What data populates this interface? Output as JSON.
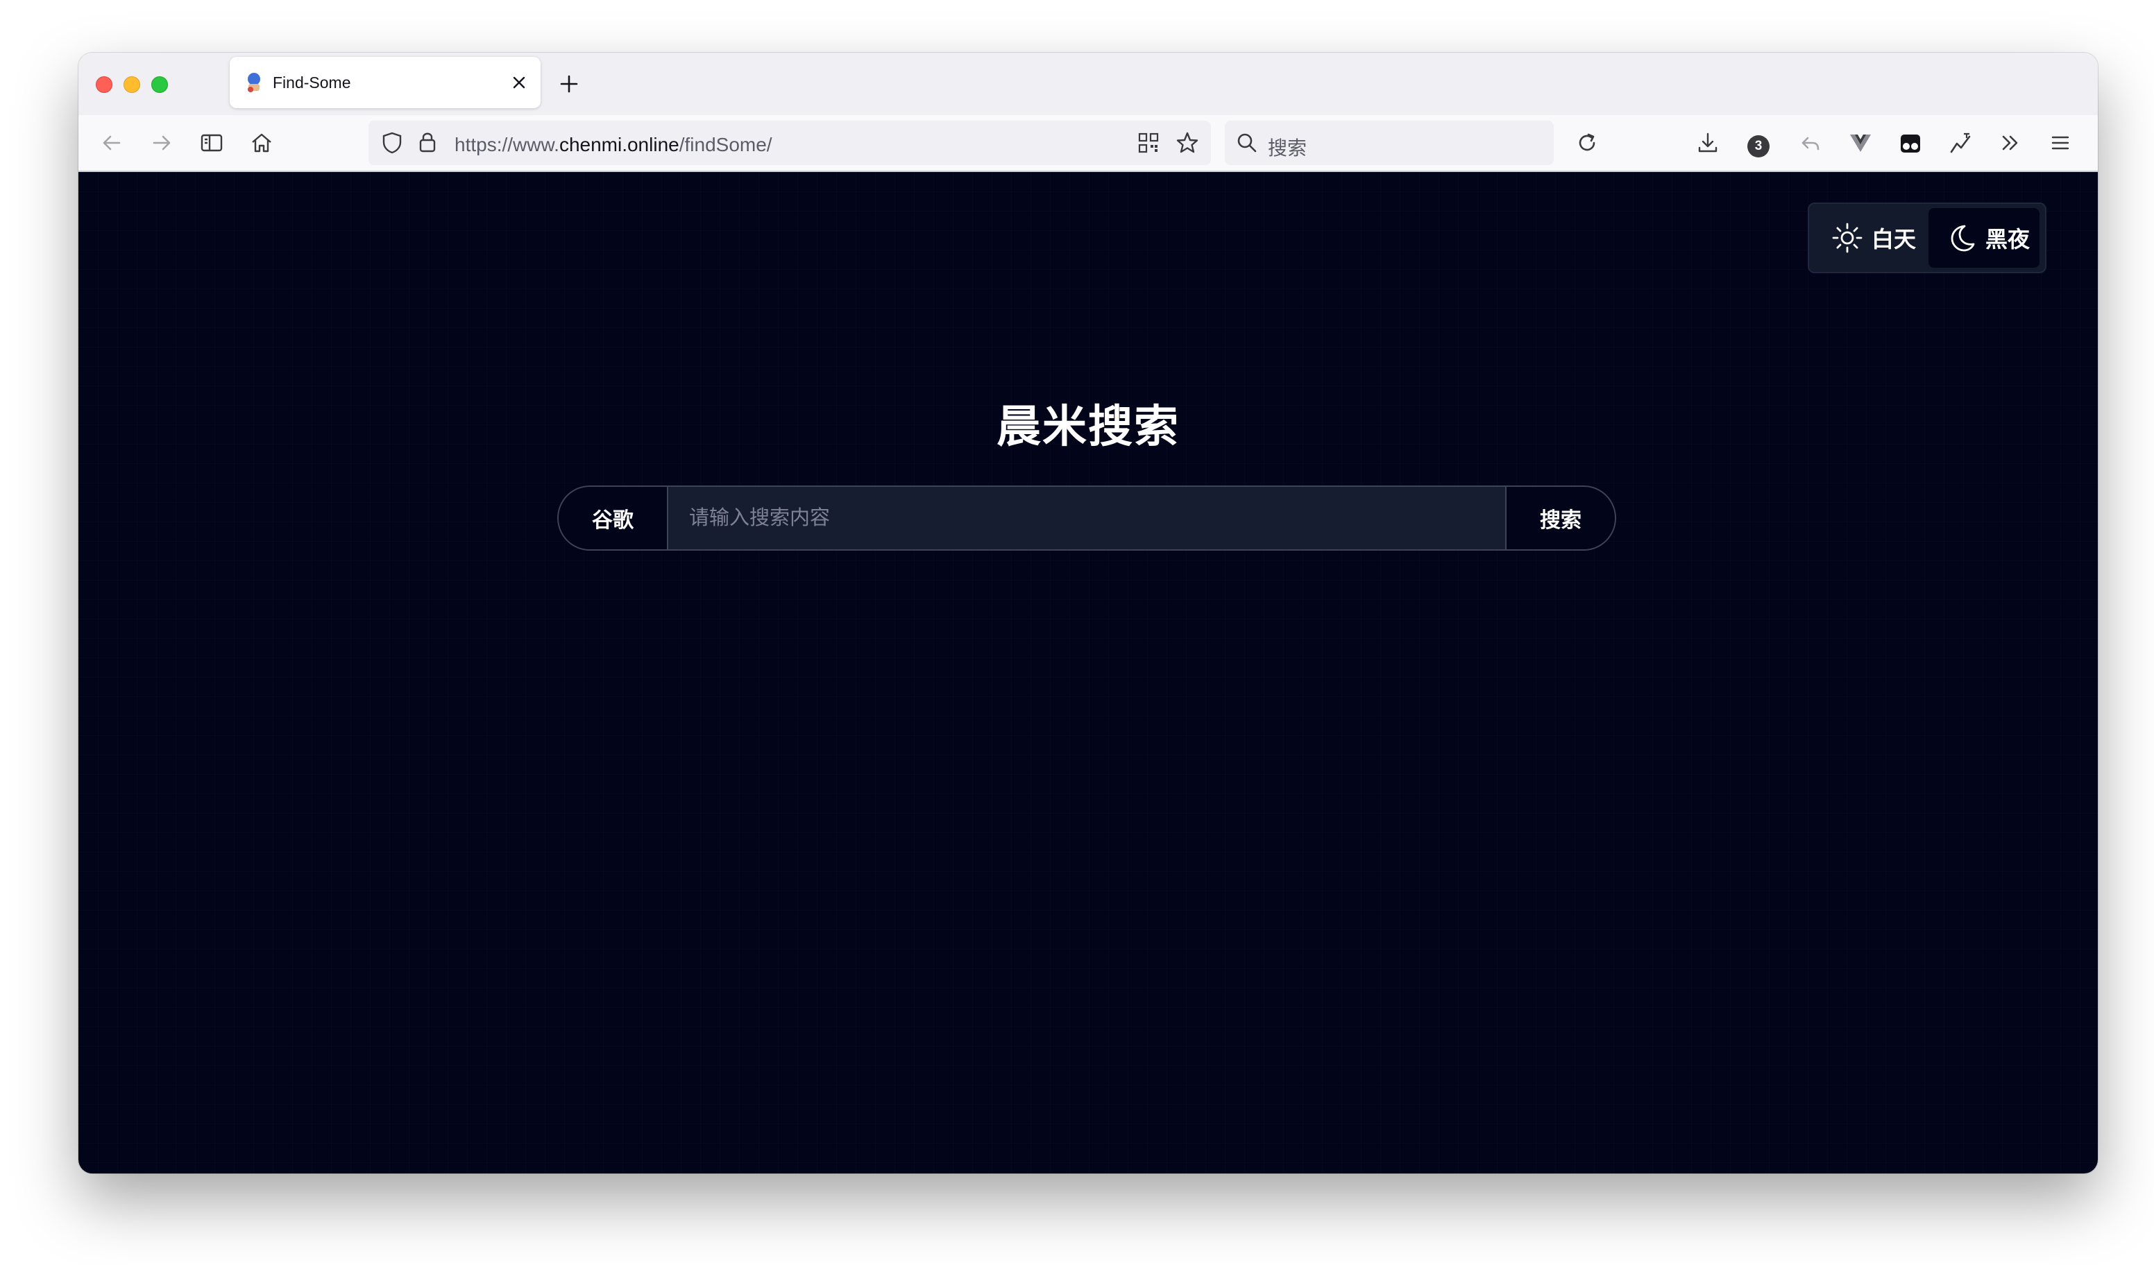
{
  "browser": {
    "tab": {
      "title": "Find-Some"
    },
    "address": {
      "prefix": "https://www.",
      "host": "chenmi.online",
      "path": "/findSome/"
    },
    "search_placeholder": "搜索",
    "downloads_badge": "3"
  },
  "page": {
    "theme_toggle": {
      "day_label": "白天",
      "night_label": "黑夜",
      "active": "night"
    },
    "title": "晨米搜索",
    "search": {
      "engine_label": "谷歌",
      "placeholder": "请输入搜索内容",
      "value": "",
      "submit_label": "搜索"
    }
  },
  "colors": {
    "page_background": "#02051a",
    "search_field": "#171d30",
    "border": "#3d4358"
  }
}
